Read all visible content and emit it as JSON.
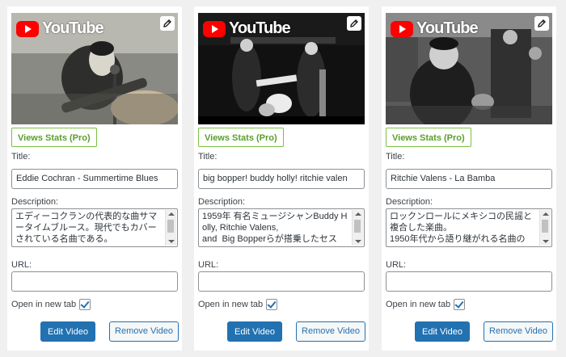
{
  "brand": {
    "youtube_word": "YouTube",
    "red": "#ff0000",
    "accent": "#2271b1",
    "stats_green": "#7ac142"
  },
  "cards": [
    {
      "views_stats": "Views Stats (Pro)",
      "title_label": "Title:",
      "title_value": "Eddie Cochran - Summertime Blues",
      "description_label": "Description:",
      "description_value": "エディーコクランの代表的な曲サマータイムブルース。現代でもカバーされている名曲である。",
      "url_label": "URL:",
      "url_value": "",
      "new_tab_label": "Open in new tab",
      "new_tab_checked": true,
      "edit_label": "Edit Video",
      "remove_label": "Remove Video"
    },
    {
      "views_stats": "Views Stats (Pro)",
      "title_label": "Title:",
      "title_value": "big bopper! buddy holly! ritchie valen",
      "description_label": "Description:",
      "description_value": "1959年 有名ミュージシャンBuddy Holly, Ritchie Valens,\nand  Big Bopperらが搭乗したセス",
      "url_label": "URL:",
      "url_value": "",
      "new_tab_label": "Open in new tab",
      "new_tab_checked": true,
      "edit_label": "Edit Video",
      "remove_label": "Remove Video"
    },
    {
      "views_stats": "Views Stats (Pro)",
      "title_label": "Title:",
      "title_value": "Ritchie Valens - La Bamba",
      "description_label": "Description:",
      "description_value": "ロックンロールにメキシコの民謡と複合した楽曲。\n1950年代から語り継がれる名曲の",
      "url_label": "URL:",
      "url_value": "",
      "new_tab_label": "Open in new tab",
      "new_tab_checked": true,
      "edit_label": "Edit Video",
      "remove_label": "Remove Video"
    }
  ]
}
